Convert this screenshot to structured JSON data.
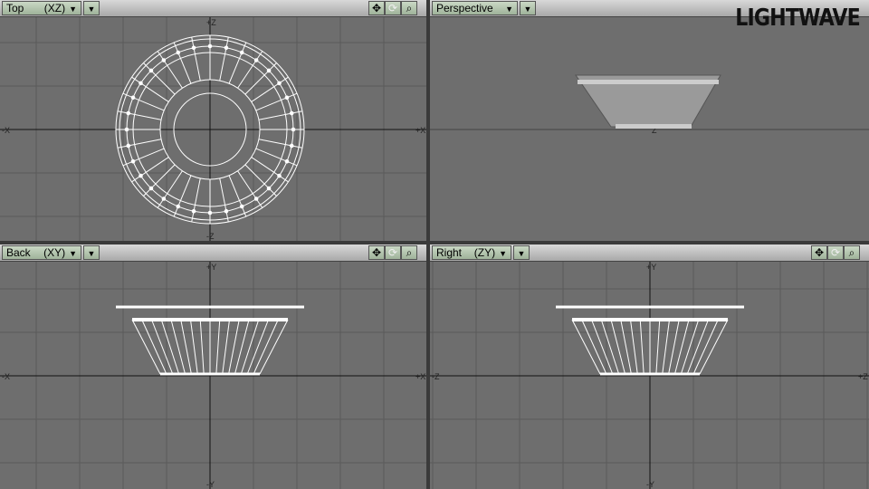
{
  "logo": "LIGHTWAVE",
  "viewports": [
    {
      "id": "top",
      "label": "Top",
      "axes": "(XZ)",
      "ticks": [
        "+Z",
        "-Z",
        "-X",
        "+X"
      ]
    },
    {
      "id": "perspective",
      "label": "Perspective",
      "axes": "",
      "ticks": [
        "Z"
      ]
    },
    {
      "id": "back",
      "label": "Back",
      "axes": "(XY)",
      "ticks": [
        "+Y",
        "-Y",
        "-X",
        "+X"
      ]
    },
    {
      "id": "right",
      "label": "Right",
      "axes": "(ZY)",
      "ticks": [
        "+Y",
        "-Y",
        "-Z",
        "+Z"
      ]
    }
  ],
  "tools": {
    "move": "move-view-icon",
    "rotate": "rotate-view-icon",
    "zoom": "zoom-view-icon"
  },
  "colors": {
    "viewport_bg": "#6e6e6e",
    "grid": "#5a5a5a",
    "wire": "#ffffff",
    "header_button": "#b4c6ae"
  }
}
